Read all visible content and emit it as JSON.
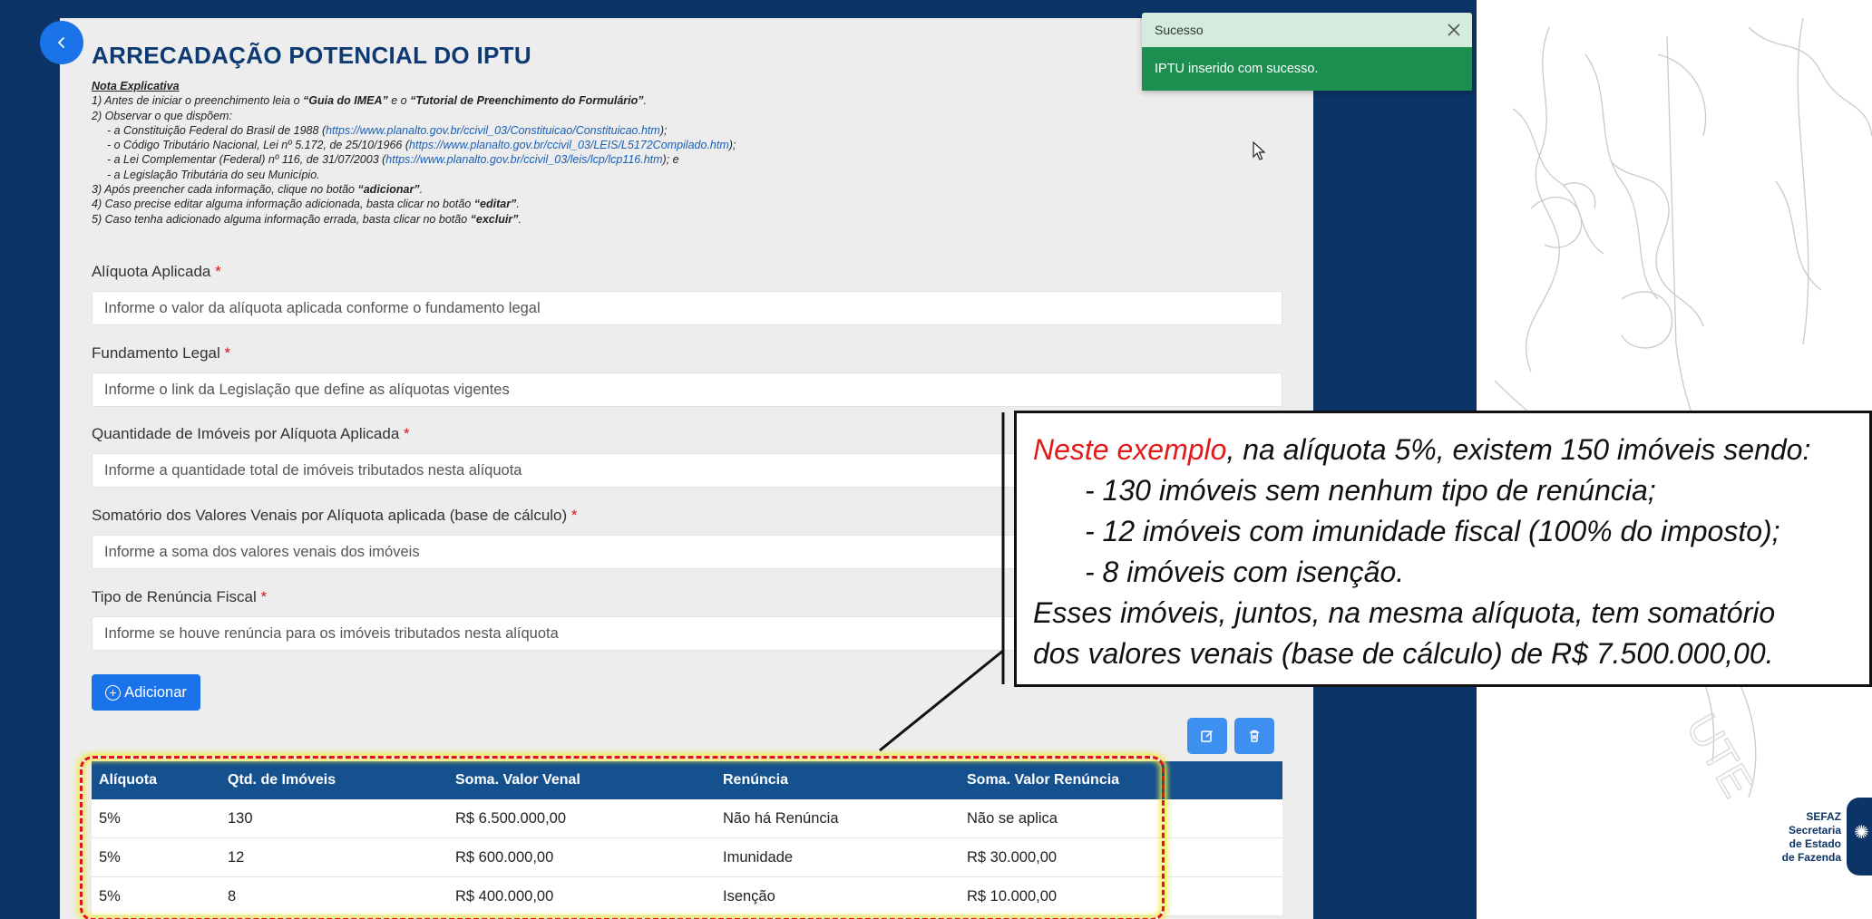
{
  "page": {
    "title": "ARRECADAÇÃO POTENCIAL DO IPTU",
    "back_icon": "chevron-left-icon"
  },
  "notes": {
    "heading": "Nota Explicativa",
    "line1_prefix": "1) Antes de iniciar o preenchimento leia o ",
    "line1_guide": "“Guia do IMEA”",
    "line1_mid": " e o ",
    "line1_tutorial": "“Tutorial de Preenchimento do Formulário”",
    "line1_end": ".",
    "line2": "2) Observar o que dispõem:",
    "law1_prefix": "- a Constituição Federal do Brasil de 1988 (",
    "law1_link": "https://www.planalto.gov.br/ccivil_03/Constituicao/Constituicao.htm",
    "law1_suffix": ");",
    "law2_prefix": "- o Código Tributário Nacional, Lei nº 5.172, de 25/10/1966 (",
    "law2_link": "https://www.planalto.gov.br/ccivil_03/LEIS/L5172Compilado.htm",
    "law2_suffix": ");",
    "law3_prefix": "- a Lei Complementar (Federal) nº 116, de 31/07/2003 (",
    "law3_link": "https://www.planalto.gov.br/ccivil_03/leis/lcp/lcp116.htm",
    "law3_suffix": "); e",
    "law4": "- a Legislação Tributária do seu Município.",
    "line3_prefix": "3) Após preencher cada informação, clique no botão ",
    "line3_btn": "“adicionar”",
    "line3_end": ".",
    "line4_prefix": "4) Caso precise editar alguma informação adicionada, basta clicar no botão ",
    "line4_btn": "“editar”",
    "line4_end": ".",
    "line5_prefix": "5) Caso tenha adicionado alguma informação errada, basta clicar no botão ",
    "line5_btn": "“excluir”",
    "line5_end": "."
  },
  "form": {
    "required_mark": "*",
    "aliquota": {
      "label": "Alíquota Aplicada",
      "placeholder": "Informe o valor da alíquota aplicada conforme o fundamento legal"
    },
    "fundamento": {
      "label": "Fundamento Legal",
      "placeholder": "Informe o link da Legislação que define as alíquotas vigentes"
    },
    "quantidade": {
      "label": "Quantidade de Imóveis por Alíquota Aplicada ",
      "placeholder": "Informe a quantidade total de imóveis tributados nesta alíquota"
    },
    "somatorio": {
      "label": "Somatório dos Valores Venais por Alíquota aplicada (base de cálculo)",
      "placeholder": "Informe a soma dos valores venais dos imóveis"
    },
    "renuncia": {
      "label": "Tipo de Renúncia Fiscal",
      "placeholder": "Informe se houve renúncia para os imóveis tributados nesta alíquota"
    },
    "add_button": "Adicionar",
    "add_icon": "plus-circle-icon"
  },
  "actions": {
    "edit_icon": "edit-icon",
    "delete_icon": "trash-icon"
  },
  "table": {
    "headers": [
      "Alíquota",
      "Qtd. de Imóveis",
      "Soma. Valor Venal",
      "Renúncia",
      "Soma. Valor Renúncia"
    ],
    "rows": [
      [
        "5%",
        "130",
        "R$ 6.500.000,00",
        "Não há Renúncia",
        "Não se aplica"
      ],
      [
        "5%",
        "12",
        "R$ 600.000,00",
        "Imunidade",
        "R$ 30.000,00"
      ],
      [
        "5%",
        "8",
        "R$ 400.000,00",
        "Isenção",
        "R$ 10.000,00"
      ]
    ]
  },
  "toast": {
    "title": "Sucesso",
    "message": "IPTU inserido com sucesso.",
    "close_icon": "close-icon"
  },
  "callout": {
    "highlight": "Neste exemplo",
    "intro_rest": ", na alíquota 5%, existem 150 imóveis sendo:",
    "item1": "- 130 imóveis sem nenhum tipo de renúncia;",
    "item2": "- 12 imóveis com imunidade fiscal (100% do imposto);",
    "item3": "- 8 imóveis com isenção.",
    "summary1": "Esses imóveis, juntos, na mesma alíquota, tem somatório",
    "summary2": "dos valores venais (base de cálculo) de R$ 7.500.000,00."
  },
  "brand": {
    "line1": "SEFAZ",
    "line2": "Secretaria",
    "line3": "de Estado",
    "line4": "de Fazenda"
  },
  "colors": {
    "background": "#0d3466",
    "title": "#0d3a73",
    "primary_button": "#1a73e8",
    "table_header": "#15518f",
    "toast_success": "#1c8e50",
    "callout_highlight": "#e21a1a",
    "dashed_highlight": "#e0141e"
  }
}
